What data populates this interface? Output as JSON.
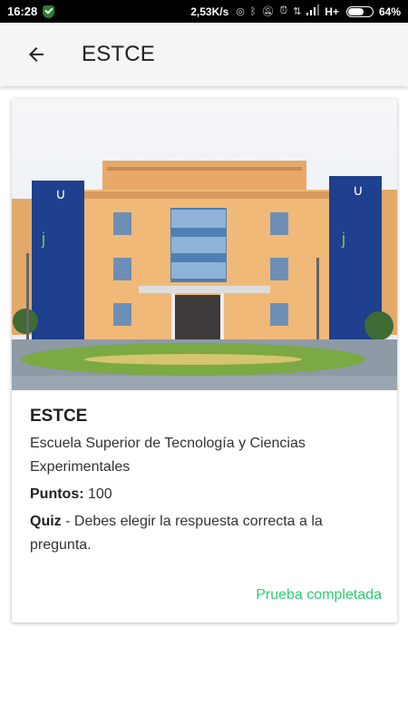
{
  "status_bar": {
    "time": "16:28",
    "speed": "2,53K/s",
    "network": "H+",
    "battery_pct": "64%",
    "battery_level": 0.64
  },
  "app_bar": {
    "title": "ESTCE",
    "back_icon": "arrow-back-icon"
  },
  "card": {
    "image_icon": "building-photo",
    "title": "ESTCE",
    "description": "Escuela Superior de Tecnología y Ciencias Experimentales",
    "points_label": "Puntos:",
    "points_value": " 100",
    "type_label": "Quiz",
    "type_desc": " - Debes elegir la respuesta correcta a la pregunta.",
    "status": "Prueba completada"
  },
  "colors": {
    "accent_green": "#2ecc71",
    "app_bar_bg": "#f5f5f5",
    "status_bar_bg": "#000000"
  }
}
